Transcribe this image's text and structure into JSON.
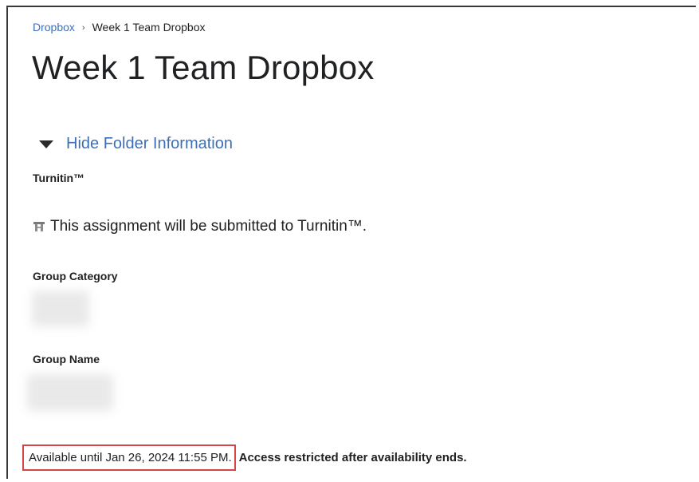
{
  "breadcrumb": {
    "parent": "Dropbox",
    "separator": "›",
    "current": "Week 1 Team Dropbox"
  },
  "page_title": "Week 1 Team Dropbox",
  "toggle": {
    "label": "Hide Folder Information"
  },
  "turnitin": {
    "heading": "Turnitin™",
    "message": "This assignment will be submitted to Turnitin™.",
    "icon": "turnitin-icon"
  },
  "group_category": {
    "heading": "Group Category",
    "value_redacted": true
  },
  "group_name": {
    "heading": "Group Name",
    "value_redacted": true
  },
  "availability": {
    "until": "Available until Jan 26, 2024 11:55 PM.",
    "restriction": "Access restricted after availability ends."
  },
  "colors": {
    "link": "#3d6fb8",
    "highlight_border": "#d64545",
    "text": "#202122"
  }
}
